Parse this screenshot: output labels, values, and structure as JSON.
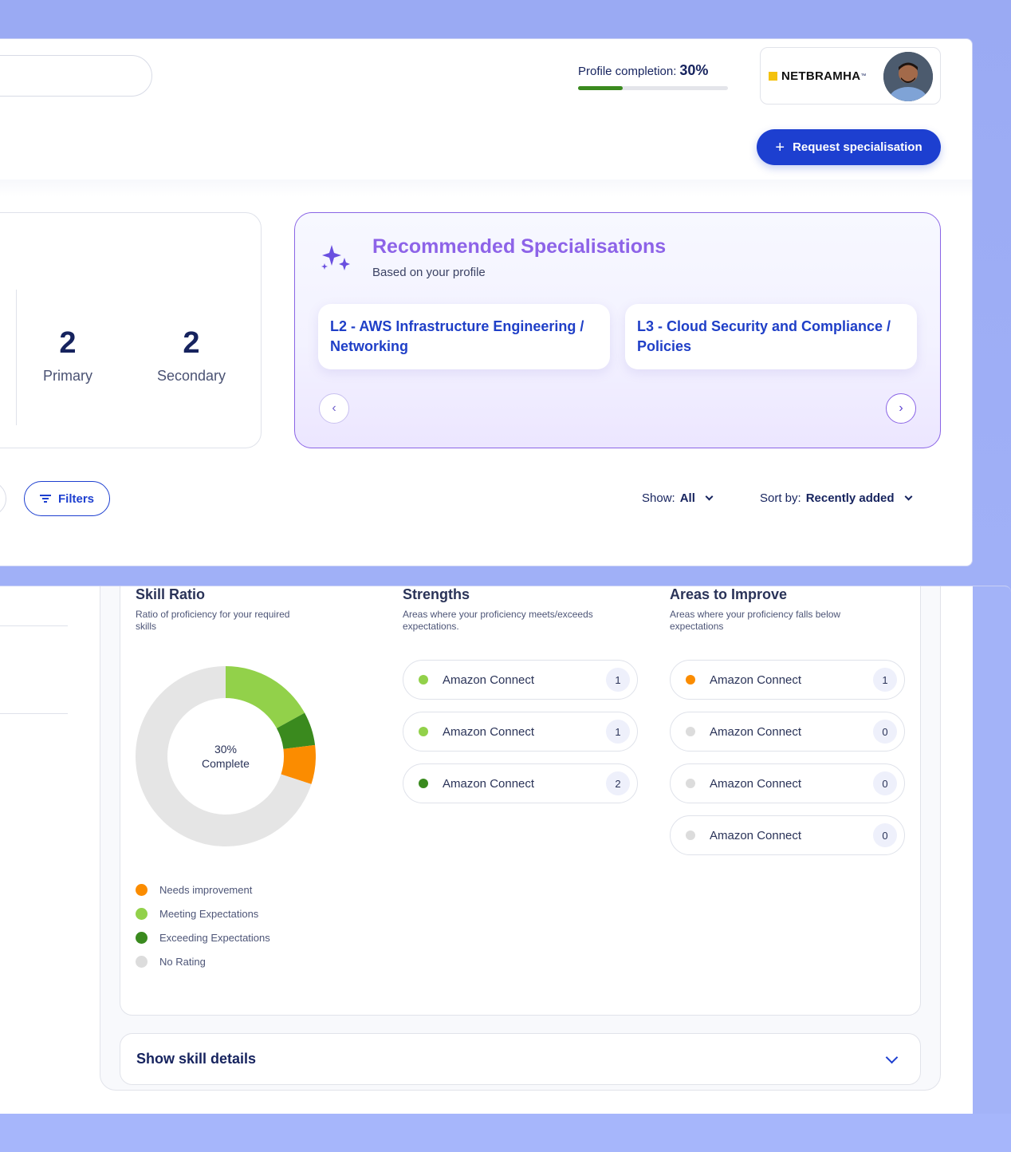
{
  "header": {
    "profile_completion_label": "Profile completion:",
    "profile_completion_value": "30%",
    "profile_completion_fraction": 0.3,
    "brand_name": "NETBRAMHA",
    "brand_tm": "™",
    "request_button_label": "Request specialisation"
  },
  "stats": {
    "primary_count": "2",
    "primary_label": "Primary",
    "secondary_count": "2",
    "secondary_label": "Secondary"
  },
  "recommended": {
    "title": "Recommended Specialisations",
    "subtitle": "Based on your profile",
    "cards": [
      {
        "label": "L2 - AWS Infrastructure Engineering / Networking"
      },
      {
        "label": "L3 - Cloud Security and Compliance / Policies"
      }
    ]
  },
  "toolbar": {
    "filters_label": "Filters",
    "show_label": "Show:",
    "show_value": "All",
    "sort_label": "Sort by:",
    "sort_value": "Recently added"
  },
  "skill_ratio": {
    "title": "Skill Ratio",
    "subtitle": "Ratio of proficiency for your required skills",
    "center_value": "30%",
    "center_label": "Complete",
    "legend": [
      {
        "label": "Needs improvement",
        "color": "#fb8c00"
      },
      {
        "label": "Meeting Expectations",
        "color": "#92d14a"
      },
      {
        "label": "Exceeding Expectations",
        "color": "#3a8a1e"
      },
      {
        "label": "No Rating",
        "color": "#dcdcdc"
      }
    ]
  },
  "chart_data": {
    "type": "pie",
    "donut": true,
    "categories": [
      "Meeting Expectations",
      "Exceeding Expectations",
      "Needs improvement",
      "No Rating"
    ],
    "values": [
      17,
      6,
      7,
      70
    ],
    "colors": [
      "#92d14a",
      "#3a8a1e",
      "#fb8c00",
      "#e5e5e5"
    ],
    "title": "",
    "center_text": "30% Complete"
  },
  "strengths": {
    "title": "Strengths",
    "subtitle": "Areas where your proficiency meets/exceeds expectations.",
    "items": [
      {
        "name": "Amazon Connect",
        "count": "1",
        "color": "#92d14a"
      },
      {
        "name": "Amazon Connect",
        "count": "1",
        "color": "#92d14a"
      },
      {
        "name": "Amazon Connect",
        "count": "2",
        "color": "#3a8a1e"
      }
    ]
  },
  "improve": {
    "title": "Areas to Improve",
    "subtitle": "Areas where your proficiency falls below expectations",
    "items": [
      {
        "name": "Amazon Connect",
        "count": "1",
        "color": "#fb8c00"
      },
      {
        "name": "Amazon Connect",
        "count": "0",
        "color": "#dcdcdc"
      },
      {
        "name": "Amazon Connect",
        "count": "0",
        "color": "#dcdcdc"
      },
      {
        "name": "Amazon Connect",
        "count": "0",
        "color": "#dcdcdc"
      }
    ]
  },
  "details": {
    "label": "Show skill details"
  }
}
